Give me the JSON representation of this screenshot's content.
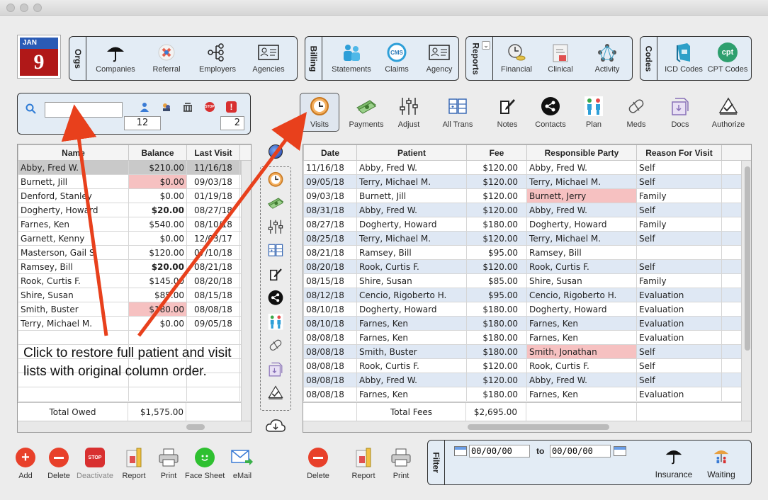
{
  "window": {
    "controls": [
      "close",
      "minimize",
      "zoom"
    ]
  },
  "calendar": {
    "month": "JAN",
    "day": "9"
  },
  "orgs": {
    "label": "Orgs",
    "items": [
      {
        "label": "Companies",
        "icon": "umbrella-icon"
      },
      {
        "label": "Referral",
        "icon": "referral-icon"
      },
      {
        "label": "Employers",
        "icon": "org-chart-icon"
      },
      {
        "label": "Agencies",
        "icon": "id-card-icon"
      }
    ]
  },
  "billing": {
    "label": "Billing",
    "items": [
      {
        "label": "Statements",
        "icon": "people-icon"
      },
      {
        "label": "Claims",
        "icon": "cms-icon"
      },
      {
        "label": "Agency",
        "icon": "id-card-icon"
      }
    ]
  },
  "reports": {
    "label": "Reports",
    "items": [
      {
        "label": "Financial",
        "icon": "clock-coins-icon"
      },
      {
        "label": "Clinical",
        "icon": "clipboard-icon"
      },
      {
        "label": "Activity",
        "icon": "network-icon"
      }
    ]
  },
  "codes": {
    "label": "Codes",
    "items": [
      {
        "label": "ICD Codes",
        "icon": "book-icon"
      },
      {
        "label": "CPT Codes",
        "icon": "cpt-icon"
      }
    ]
  },
  "search": {
    "value": "",
    "count": "12",
    "right_count": "2"
  },
  "visit_toolbar": [
    {
      "label": "Visits",
      "icon": "clock-icon"
    },
    {
      "label": "Payments",
      "icon": "money-icon"
    },
    {
      "label": "Adjust",
      "icon": "sliders-icon"
    },
    {
      "label": "All Trans",
      "icon": "grid-icon"
    },
    {
      "label": "Notes",
      "icon": "note-icon"
    },
    {
      "label": "Contacts",
      "icon": "share-icon"
    },
    {
      "label": "Plan",
      "icon": "plan-icon"
    },
    {
      "label": "Meds",
      "icon": "pill-icon"
    },
    {
      "label": "Docs",
      "icon": "docs-icon"
    },
    {
      "label": "Authorize",
      "icon": "authorize-icon"
    }
  ],
  "patients": {
    "headers": [
      "Name",
      "Balance",
      "Last Visit"
    ],
    "rows": [
      {
        "name": "Abby, Fred W.",
        "balance": "$210.00",
        "last": "11/16/18",
        "bold": false,
        "pink": false,
        "selected": true
      },
      {
        "name": "Burnett, Jill",
        "balance": "$0.00",
        "last": "09/03/18",
        "bold": false,
        "pink": true,
        "selected": false
      },
      {
        "name": "Denford, Stanley",
        "balance": "$0.00",
        "last": "01/19/18",
        "bold": false,
        "pink": false,
        "selected": false
      },
      {
        "name": "Dogherty, Howard",
        "balance": "$20.00",
        "last": "08/27/18",
        "bold": true,
        "pink": false,
        "selected": false
      },
      {
        "name": "Farnes, Ken",
        "balance": "$540.00",
        "last": "08/10/18",
        "bold": false,
        "pink": false,
        "selected": false
      },
      {
        "name": "Garnett, Kenny",
        "balance": "$0.00",
        "last": "12/03/17",
        "bold": false,
        "pink": false,
        "selected": false
      },
      {
        "name": "Masterson, Gail S.",
        "balance": "$120.00",
        "last": "07/10/18",
        "bold": false,
        "pink": false,
        "selected": false
      },
      {
        "name": "Ramsey, Bill",
        "balance": "$20.00",
        "last": "08/21/18",
        "bold": true,
        "pink": false,
        "selected": false
      },
      {
        "name": "Rook, Curtis F.",
        "balance": "$145.00",
        "last": "08/20/18",
        "bold": false,
        "pink": false,
        "selected": false
      },
      {
        "name": "Shire, Susan",
        "balance": "$85.00",
        "last": "08/15/18",
        "bold": false,
        "pink": false,
        "selected": false
      },
      {
        "name": "Smith, Buster",
        "balance": "$180.00",
        "last": "08/08/18",
        "bold": false,
        "pink": true,
        "selected": false
      },
      {
        "name": "Terry, Michael M.",
        "balance": "$0.00",
        "last": "09/05/18",
        "bold": false,
        "pink": false,
        "selected": false
      }
    ],
    "total_label": "Total Owed",
    "total_value": "$1,575.00"
  },
  "annotation": "Click to restore full patient and visit lists with original column order.",
  "visits": {
    "headers": [
      "Date",
      "Patient",
      "Fee",
      "Responsible Party",
      "Reason For Visit"
    ],
    "rows": [
      {
        "date": "11/16/18",
        "patient": "Abby, Fred W.",
        "fee": "$120.00",
        "party": "Abby, Fred W.",
        "reason": "Self",
        "blue": false,
        "pink": false
      },
      {
        "date": "09/05/18",
        "patient": "Terry, Michael M.",
        "fee": "$120.00",
        "party": "Terry, Michael M.",
        "reason": "Self",
        "blue": true,
        "pink": false
      },
      {
        "date": "09/03/18",
        "patient": "Burnett, Jill",
        "fee": "$120.00",
        "party": "Burnett, Jerry",
        "reason": "Family",
        "blue": false,
        "pink": true
      },
      {
        "date": "08/31/18",
        "patient": "Abby, Fred W.",
        "fee": "$120.00",
        "party": "Abby, Fred W.",
        "reason": "Self",
        "blue": true,
        "pink": false
      },
      {
        "date": "08/27/18",
        "patient": "Dogherty, Howard",
        "fee": "$180.00",
        "party": "Dogherty, Howard",
        "reason": "Family",
        "blue": false,
        "pink": false
      },
      {
        "date": "08/25/18",
        "patient": "Terry, Michael M.",
        "fee": "$120.00",
        "party": "Terry, Michael M.",
        "reason": "Self",
        "blue": true,
        "pink": false
      },
      {
        "date": "08/21/18",
        "patient": "Ramsey, Bill",
        "fee": "$95.00",
        "party": "Ramsey, Bill",
        "reason": "",
        "blue": false,
        "pink": false
      },
      {
        "date": "08/20/18",
        "patient": "Rook, Curtis F.",
        "fee": "$120.00",
        "party": "Rook, Curtis F.",
        "reason": "Self",
        "blue": true,
        "pink": false
      },
      {
        "date": "08/15/18",
        "patient": "Shire, Susan",
        "fee": "$85.00",
        "party": "Shire, Susan",
        "reason": "Family",
        "blue": false,
        "pink": false
      },
      {
        "date": "08/12/18",
        "patient": "Cencio, Rigoberto H.",
        "fee": "$95.00",
        "party": "Cencio, Rigoberto H.",
        "reason": "Evaluation",
        "blue": true,
        "pink": false
      },
      {
        "date": "08/10/18",
        "patient": "Dogherty, Howard",
        "fee": "$180.00",
        "party": "Dogherty, Howard",
        "reason": "Evaluation",
        "blue": false,
        "pink": false
      },
      {
        "date": "08/10/18",
        "patient": "Farnes, Ken",
        "fee": "$180.00",
        "party": "Farnes, Ken",
        "reason": "Evaluation",
        "blue": true,
        "pink": false
      },
      {
        "date": "08/08/18",
        "patient": "Farnes, Ken",
        "fee": "$180.00",
        "party": "Farnes, Ken",
        "reason": "Evaluation",
        "blue": false,
        "pink": false
      },
      {
        "date": "08/08/18",
        "patient": "Smith, Buster",
        "fee": "$180.00",
        "party": "Smith, Jonathan",
        "reason": "Self",
        "blue": true,
        "pink": true
      },
      {
        "date": "08/08/18",
        "patient": "Rook, Curtis F.",
        "fee": "$120.00",
        "party": "Rook, Curtis F.",
        "reason": "Self",
        "blue": false,
        "pink": false
      },
      {
        "date": "08/08/18",
        "patient": "Abby, Fred W.",
        "fee": "$120.00",
        "party": "Abby, Fred W.",
        "reason": "Self",
        "blue": true,
        "pink": false
      },
      {
        "date": "08/08/18",
        "patient": "Farnes, Ken",
        "fee": "$180.00",
        "party": "Farnes, Ken",
        "reason": "Evaluation",
        "blue": false,
        "pink": false
      }
    ],
    "total_label": "Total Fees",
    "total_value": "$2,695.00"
  },
  "patient_buttons": [
    {
      "label": "Add",
      "icon": "add-icon"
    },
    {
      "label": "Delete",
      "icon": "delete-icon"
    },
    {
      "label": "Deactivate",
      "icon": "stop-icon"
    },
    {
      "label": "Report",
      "icon": "report-icon"
    },
    {
      "label": "Print",
      "icon": "print-icon"
    },
    {
      "label": "Face Sheet",
      "icon": "face-icon"
    },
    {
      "label": "eMail",
      "icon": "email-icon"
    }
  ],
  "visit_buttons": [
    {
      "label": "Delete",
      "icon": "delete-icon"
    },
    {
      "label": "Report",
      "icon": "report-icon"
    },
    {
      "label": "Print",
      "icon": "print-icon"
    }
  ],
  "filter": {
    "label": "Filter",
    "from": "00/00/00",
    "to_label": "to",
    "to": "00/00/00",
    "items": [
      {
        "label": "Insurance",
        "icon": "umbrella-icon"
      },
      {
        "label": "Waiting",
        "icon": "waiting-icon"
      }
    ]
  },
  "colors": {
    "pink": "#f6c1c1",
    "blue_row": "#dfe8f4",
    "selected": "#c9c9c9",
    "arrow": "#e8401c",
    "panel": "#e3ecf5"
  }
}
